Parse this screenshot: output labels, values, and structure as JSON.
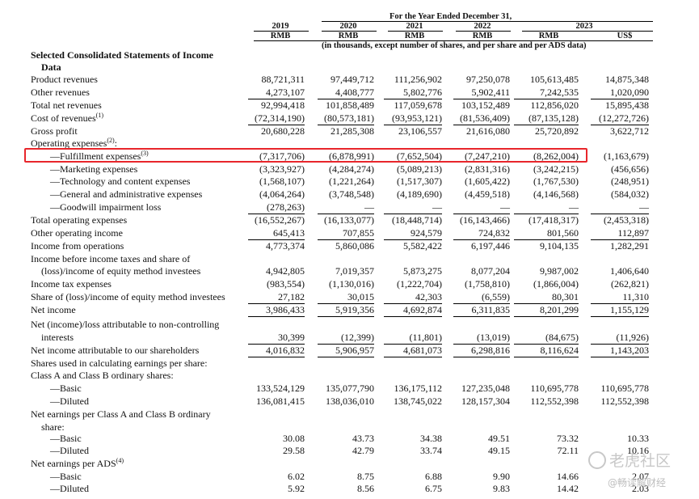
{
  "header": {
    "period": "For the Year Ended December 31,",
    "years": [
      "2019",
      "2020",
      "2021",
      "2022",
      "2023"
    ],
    "currencies": [
      "RMB",
      "RMB",
      "RMB",
      "RMB",
      "RMB",
      "US$"
    ],
    "note": "(in thousands, except number of shares, and per share and per ADS data)"
  },
  "rows": [
    {
      "label": "Selected Consolidated Statements of Income",
      "style": "bold",
      "values": []
    },
    {
      "label": "Data",
      "style": "bold",
      "indent": 1,
      "values": []
    },
    {
      "label": "Product revenues",
      "values": [
        "88,721,311",
        "97,449,712",
        "111,256,902",
        "97,250,078",
        "105,613,485",
        "14,875,348"
      ]
    },
    {
      "label": "Other revenues",
      "values": [
        "4,273,107",
        "4,408,777",
        "5,802,776",
        "5,902,411",
        "7,242,535",
        "1,020,090"
      ],
      "underline": true
    },
    {
      "label": "Total net revenues",
      "values": [
        "92,994,418",
        "101,858,489",
        "117,059,678",
        "103,152,489",
        "112,856,020",
        "15,895,438"
      ]
    },
    {
      "label": "Cost of revenues",
      "sup": "(1)",
      "values": [
        "(72,314,190)",
        "(80,573,181)",
        "(93,953,121)",
        "(81,536,409)",
        "(87,135,128)",
        "(12,272,726)"
      ],
      "underline": true
    },
    {
      "label": "Gross profit",
      "values": [
        "20,680,228",
        "21,285,308",
        "23,106,557",
        "21,616,080",
        "25,720,892",
        "3,622,712"
      ]
    },
    {
      "label": "Operating expenses",
      "sup": "(2)",
      "suffix": ":",
      "values": []
    },
    {
      "label": "—Fulfillment expenses",
      "sup": "(3)",
      "indent": 2,
      "values": [
        "(7,317,706)",
        "(6,878,991)",
        "(7,652,504)",
        "(7,247,210)",
        "(8,262,004)",
        "(1,163,679)"
      ]
    },
    {
      "label": "—Marketing expenses",
      "indent": 2,
      "values": [
        "(3,323,927)",
        "(4,284,274)",
        "(5,089,213)",
        "(2,831,316)",
        "(3,242,215)",
        "(456,656)"
      ]
    },
    {
      "label": "—Technology and content expenses",
      "indent": 2,
      "values": [
        "(1,568,107)",
        "(1,221,264)",
        "(1,517,307)",
        "(1,605,422)",
        "(1,767,530)",
        "(248,951)"
      ]
    },
    {
      "label": "—General and administrative expenses",
      "indent": 2,
      "values": [
        "(4,064,264)",
        "(3,748,548)",
        "(4,189,690)",
        "(4,459,518)",
        "(4,146,568)",
        "(584,032)"
      ]
    },
    {
      "label": "—Goodwill impairment loss",
      "indent": 2,
      "values": [
        "(278,263)",
        "—",
        "—",
        "—",
        "—",
        "—"
      ],
      "underline": true
    },
    {
      "label": "Total operating expenses",
      "values": [
        "(16,552,267)",
        "(16,133,077)",
        "(18,448,714)",
        "(16,143,466)",
        "(17,418,317)",
        "(2,453,318)"
      ]
    },
    {
      "label": "Other operating income",
      "values": [
        "645,413",
        "707,855",
        "924,579",
        "724,832",
        "801,560",
        "112,897"
      ],
      "underline": true
    },
    {
      "label": "Income from operations",
      "values": [
        "4,773,374",
        "5,860,086",
        "5,582,422",
        "6,197,446",
        "9,104,135",
        "1,282,291"
      ]
    },
    {
      "label": "Income before income taxes and share of",
      "values": []
    },
    {
      "label": "(loss)/income of equity method investees",
      "indent": 1,
      "values": [
        "4,942,805",
        "7,019,357",
        "5,873,275",
        "8,077,204",
        "9,987,002",
        "1,406,640"
      ]
    },
    {
      "label": "Income tax expenses",
      "values": [
        "(983,554)",
        "(1,130,016)",
        "(1,222,704)",
        "(1,758,810)",
        "(1,866,004)",
        "(262,821)"
      ]
    },
    {
      "label": "Share of (loss)/income of equity method investees",
      "values": [
        "27,182",
        "30,015",
        "42,303",
        "(6,559)",
        "80,301",
        "11,310"
      ],
      "underline": true
    },
    {
      "label": "Net income",
      "values": [
        "3,986,433",
        "5,919,356",
        "4,692,874",
        "6,311,835",
        "8,201,299",
        "1,155,129"
      ],
      "underline": true
    },
    {
      "label": "Net (income)/loss attributable to non-controlling",
      "values": []
    },
    {
      "label": "interests",
      "indent": 1,
      "values": [
        "30,399",
        "(12,399)",
        "(11,801)",
        "(13,019)",
        "(84,675)",
        "(11,926)"
      ],
      "underline": true
    },
    {
      "label": "Net income attributable to our shareholders",
      "values": [
        "4,016,832",
        "5,906,957",
        "4,681,073",
        "6,298,816",
        "8,116,624",
        "1,143,203"
      ],
      "underline": true
    },
    {
      "label": "Shares used in calculating earnings per share:",
      "values": []
    },
    {
      "label": "Class A and Class B ordinary shares:",
      "values": []
    },
    {
      "label": "—Basic",
      "indent": 2,
      "values": [
        "133,524,129",
        "135,077,790",
        "136,175,112",
        "127,235,048",
        "110,695,778",
        "110,695,778"
      ]
    },
    {
      "label": "—Diluted",
      "indent": 2,
      "values": [
        "136,081,415",
        "138,036,010",
        "138,745,022",
        "128,157,304",
        "112,552,398",
        "112,552,398"
      ]
    },
    {
      "label": "Net earnings per Class A and Class B ordinary",
      "values": []
    },
    {
      "label": "share:",
      "indent": 1,
      "values": []
    },
    {
      "label": "—Basic",
      "indent": 2,
      "values": [
        "30.08",
        "43.73",
        "34.38",
        "49.51",
        "73.32",
        "10.33"
      ]
    },
    {
      "label": "—Diluted",
      "indent": 2,
      "values": [
        "29.58",
        "42.79",
        "33.74",
        "49.15",
        "72.11",
        "10.16"
      ]
    },
    {
      "label": "Net earnings per ADS",
      "sup": "(4)",
      "values": []
    },
    {
      "label": "—Basic",
      "indent": 2,
      "values": [
        "6.02",
        "8.75",
        "6.88",
        "9.90",
        "14.66",
        "2.07"
      ]
    },
    {
      "label": "—Diluted",
      "indent": 2,
      "values": [
        "5.92",
        "8.56",
        "6.75",
        "9.83",
        "14.42",
        "2.03"
      ]
    }
  ],
  "watermark": {
    "line1": "老虎社区",
    "line2": "@畅读解财经"
  },
  "colors": {
    "highlight": "#e8262b",
    "text": "#111111",
    "watermark": "#c8c8c8"
  }
}
